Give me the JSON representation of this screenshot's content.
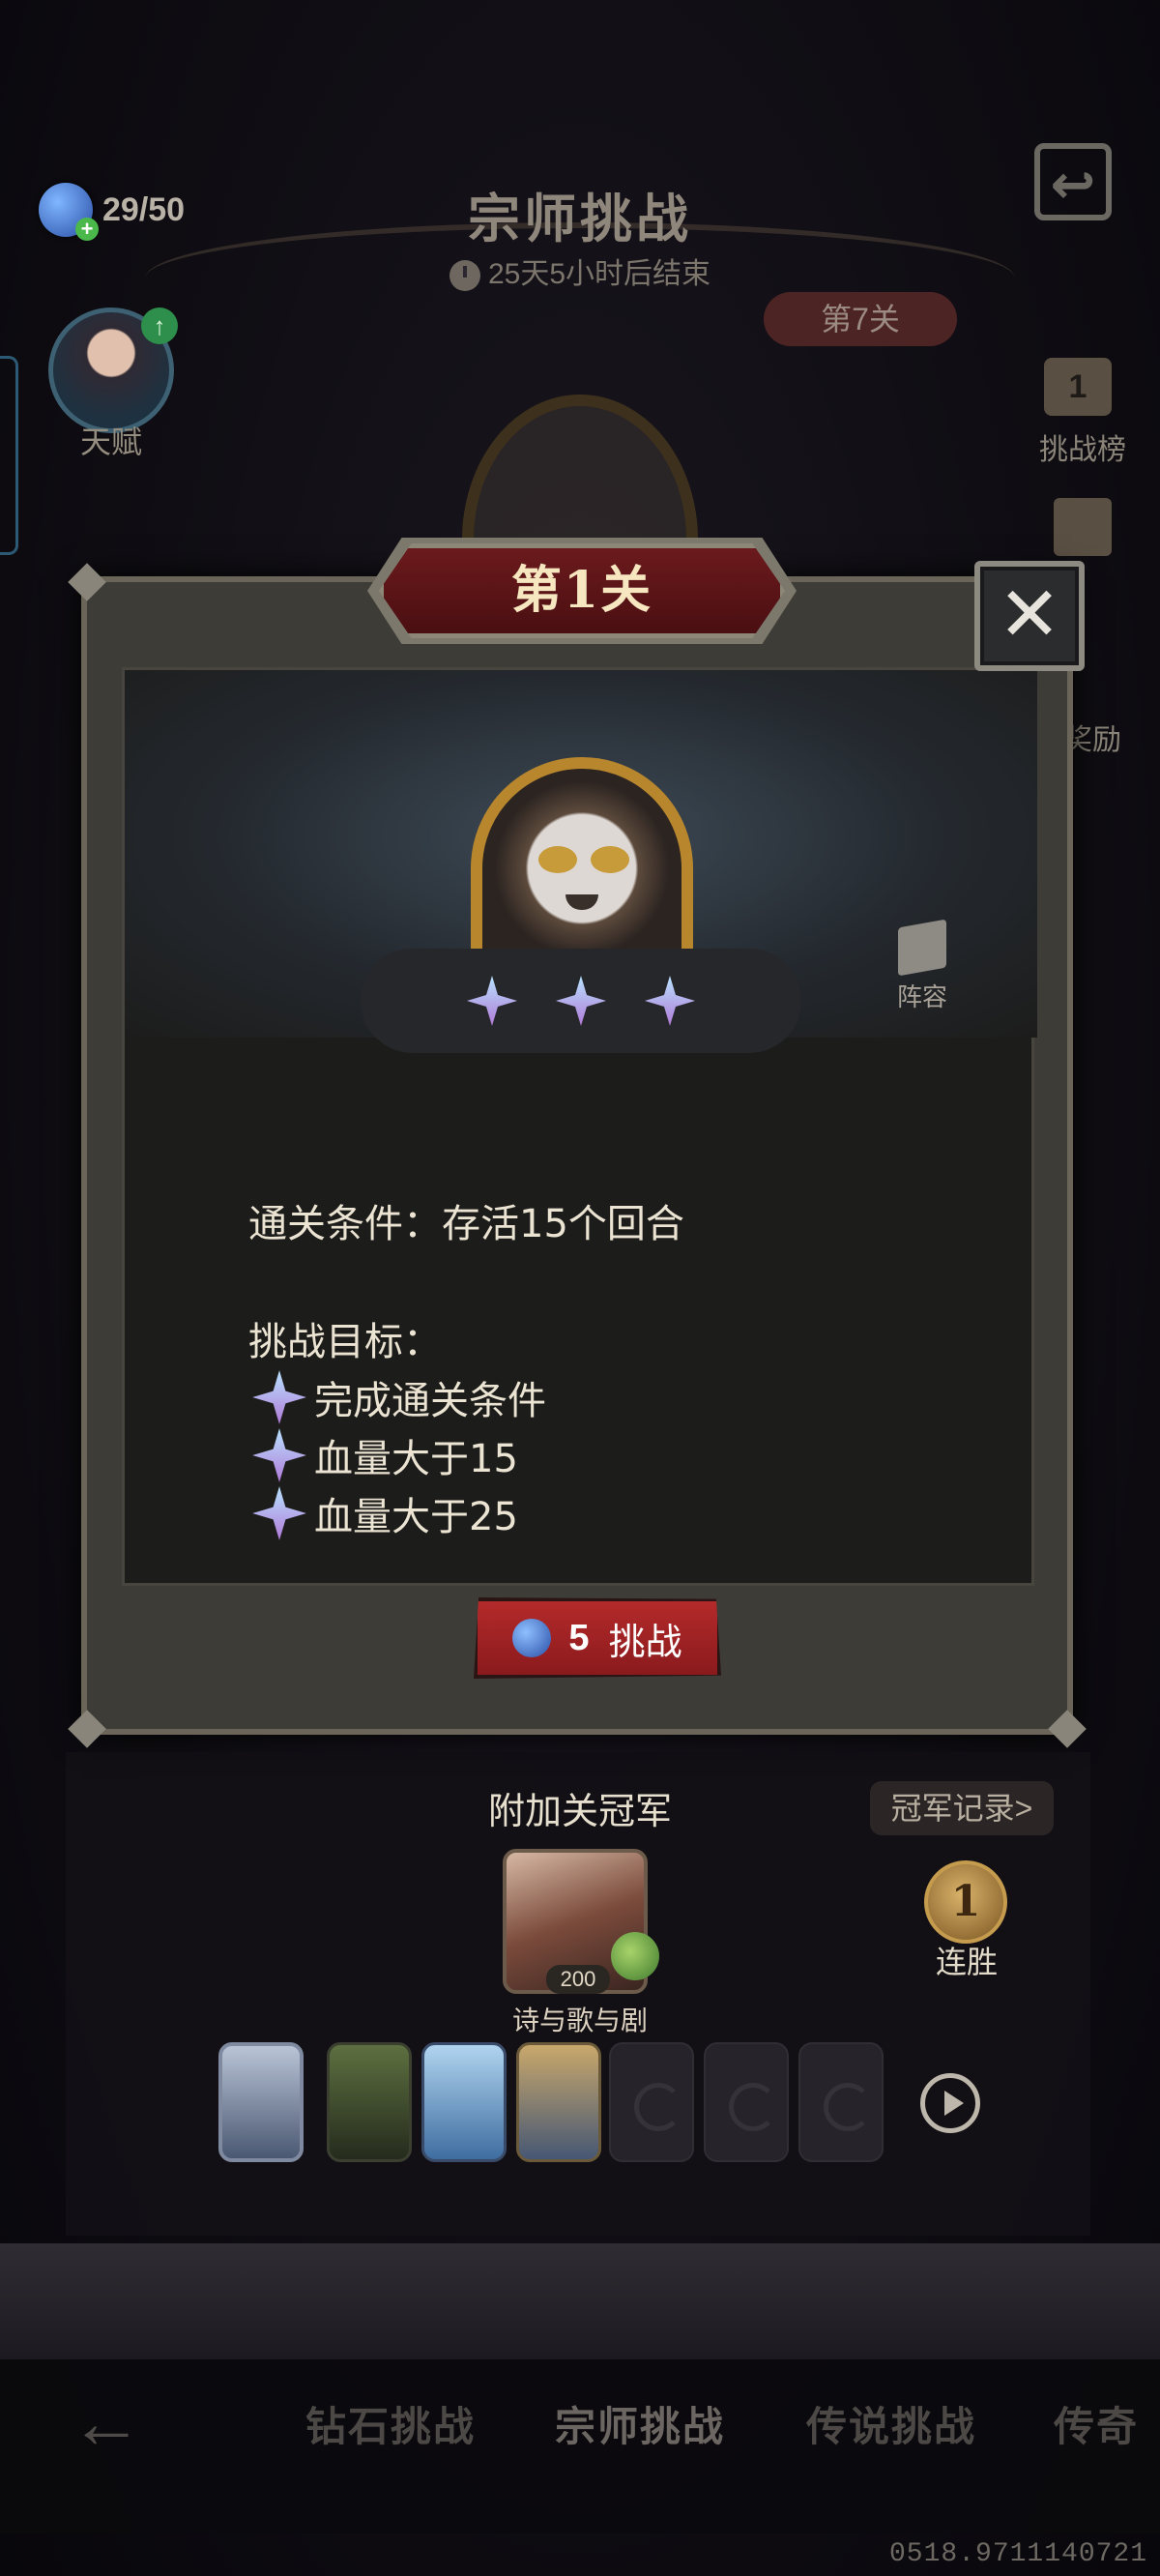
{
  "hud": {
    "stamina": "29/50",
    "title": "宗师挑战",
    "timer": "25天5小时后结束",
    "stage_tag": "第7关",
    "avatar_label": "天赋",
    "rank_icon_num": "1",
    "rank_label": "挑战榜",
    "reward_label": "奖励"
  },
  "modal": {
    "title": "第1关",
    "close_symbol": "✕",
    "lineup_label": "阵容",
    "condition": "通关条件：存活15个回合",
    "goals_title": "挑战目标：",
    "goals": [
      "完成通关条件",
      "血量大于15",
      "血量大于25"
    ],
    "challenge_cost": "5",
    "challenge_label": "挑战"
  },
  "champion": {
    "title": "附加关冠军",
    "record_link": "冠军记录>",
    "hero_level": "200",
    "player_name": "诗与歌与剧",
    "win_count": "1",
    "win_label": "连胜"
  },
  "nav": {
    "tabs": [
      "钻石挑战",
      "宗师挑战",
      "传说挑战",
      "传奇"
    ],
    "active_tab": "宗师挑战"
  },
  "version": "0518.9711140721",
  "colors": {
    "accent_red": "#a5222a",
    "gold": "#b8862d",
    "star_gradient_top": "#b8e3ff",
    "star_gradient_bottom": "#b07ad8"
  }
}
